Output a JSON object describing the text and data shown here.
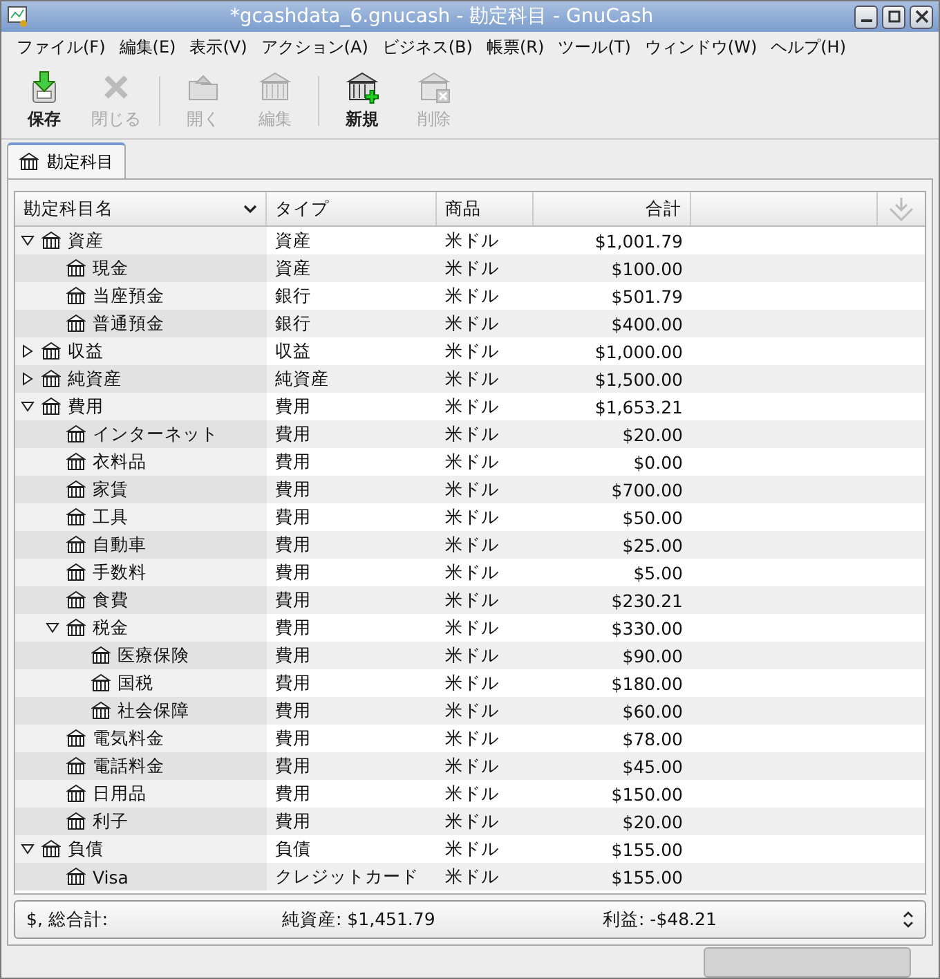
{
  "window": {
    "title": "*gcashdata_6.gnucash - 勘定科目 - GnuCash"
  },
  "menu": [
    "ファイル(F)",
    "編集(E)",
    "表示(V)",
    "アクション(A)",
    "ビジネス(B)",
    "帳票(R)",
    "ツール(T)",
    "ウィンドウ(W)",
    "ヘルプ(H)"
  ],
  "toolbar": [
    {
      "label": "保存",
      "kind": "save",
      "disabled": false
    },
    {
      "label": "閉じる",
      "kind": "close",
      "disabled": true
    },
    {
      "kind": "separator"
    },
    {
      "label": "開く",
      "kind": "open",
      "disabled": true
    },
    {
      "label": "編集",
      "kind": "edit",
      "disabled": true
    },
    {
      "kind": "separator"
    },
    {
      "label": "新規",
      "kind": "new",
      "disabled": false
    },
    {
      "label": "削除",
      "kind": "delete",
      "disabled": true
    }
  ],
  "tabs": [
    {
      "label": "勘定科目",
      "selected": true
    }
  ],
  "table": {
    "columns": [
      "勘定科目名",
      "タイプ",
      "商品",
      "合計"
    ],
    "rows": [
      {
        "name": "資産",
        "type": "資産",
        "commodity": "米ドル",
        "total": "$1,001.79",
        "expanded": true,
        "children": [
          {
            "name": "現金",
            "type": "資産",
            "commodity": "米ドル",
            "total": "$100.00"
          },
          {
            "name": "当座預金",
            "type": "銀行",
            "commodity": "米ドル",
            "total": "$501.79"
          },
          {
            "name": "普通預金",
            "type": "銀行",
            "commodity": "米ドル",
            "total": "$400.00"
          }
        ]
      },
      {
        "name": "収益",
        "type": "収益",
        "commodity": "米ドル",
        "total": "$1,000.00",
        "expanded": false
      },
      {
        "name": "純資産",
        "type": "純資産",
        "commodity": "米ドル",
        "total": "$1,500.00",
        "expanded": false
      },
      {
        "name": "費用",
        "type": "費用",
        "commodity": "米ドル",
        "total": "$1,653.21",
        "expanded": true,
        "children": [
          {
            "name": "インターネット",
            "type": "費用",
            "commodity": "米ドル",
            "total": "$20.00"
          },
          {
            "name": "衣料品",
            "type": "費用",
            "commodity": "米ドル",
            "total": "$0.00"
          },
          {
            "name": "家賃",
            "type": "費用",
            "commodity": "米ドル",
            "total": "$700.00"
          },
          {
            "name": "工具",
            "type": "費用",
            "commodity": "米ドル",
            "total": "$50.00"
          },
          {
            "name": "自動車",
            "type": "費用",
            "commodity": "米ドル",
            "total": "$25.00"
          },
          {
            "name": "手数料",
            "type": "費用",
            "commodity": "米ドル",
            "total": "$5.00"
          },
          {
            "name": "食費",
            "type": "費用",
            "commodity": "米ドル",
            "total": "$230.21"
          },
          {
            "name": "税金",
            "type": "費用",
            "commodity": "米ドル",
            "total": "$330.00",
            "expanded": true,
            "children": [
              {
                "name": "医療保険",
                "type": "費用",
                "commodity": "米ドル",
                "total": "$90.00"
              },
              {
                "name": "国税",
                "type": "費用",
                "commodity": "米ドル",
                "total": "$180.00"
              },
              {
                "name": "社会保障",
                "type": "費用",
                "commodity": "米ドル",
                "total": "$60.00"
              }
            ]
          },
          {
            "name": "電気料金",
            "type": "費用",
            "commodity": "米ドル",
            "total": "$78.00"
          },
          {
            "name": "電話料金",
            "type": "費用",
            "commodity": "米ドル",
            "total": "$45.00"
          },
          {
            "name": "日用品",
            "type": "費用",
            "commodity": "米ドル",
            "total": "$150.00"
          },
          {
            "name": "利子",
            "type": "費用",
            "commodity": "米ドル",
            "total": "$20.00"
          }
        ]
      },
      {
        "name": "負債",
        "type": "負債",
        "commodity": "米ドル",
        "total": "$155.00",
        "expanded": true,
        "children": [
          {
            "name": "Visa",
            "type": "クレジットカード",
            "commodity": "米ドル",
            "total": "$155.00"
          }
        ]
      }
    ]
  },
  "status": {
    "progress": {
      "level": 0
    }
  },
  "summary": {
    "label": "$, 総合計:",
    "net_assets": "純資産: $1,451.79",
    "profit": "利益: -$48.21"
  }
}
